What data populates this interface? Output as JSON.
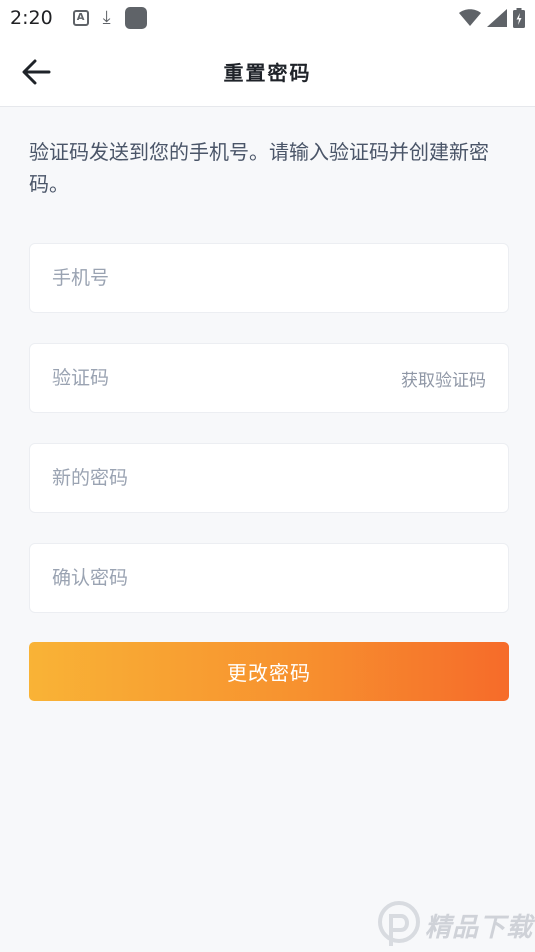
{
  "status_bar": {
    "time": "2:20",
    "icons": [
      "a-notification-icon",
      "download-icon",
      "app-notification-icon",
      "wifi-icon",
      "signal-icon",
      "battery-icon"
    ]
  },
  "header": {
    "title": "重置密码",
    "back_icon": "arrow-left-icon"
  },
  "description": "验证码发送到您的手机号。请输入验证码并创建新密码。",
  "form": {
    "phone": {
      "placeholder": "手机号",
      "value": ""
    },
    "code": {
      "placeholder": "验证码",
      "value": "",
      "get_code_label": "获取验证码"
    },
    "new_password": {
      "placeholder": "新的密码",
      "value": ""
    },
    "confirm_password": {
      "placeholder": "确认密码",
      "value": ""
    },
    "submit_label": "更改密码"
  },
  "colors": {
    "button_gradient_start": "#f9b336",
    "button_gradient_end": "#f66b2a",
    "background": "#f7f8fa",
    "placeholder": "#9aa3b2"
  },
  "watermark": {
    "logo_text": "精品下载"
  }
}
